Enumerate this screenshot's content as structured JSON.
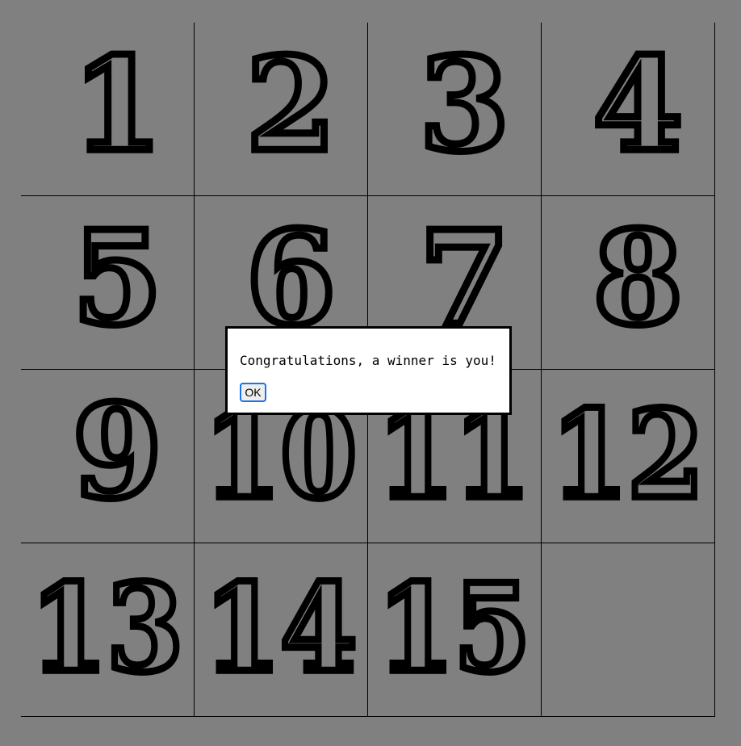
{
  "game": {
    "tiles": [
      "1",
      "2",
      "3",
      "4",
      "5",
      "6",
      "7",
      "8",
      "9",
      "10",
      "11",
      "12",
      "13",
      "14",
      "15",
      ""
    ],
    "colors": {
      "background": "#808080",
      "tile_fill": "#808080",
      "digit_outline": "#000000",
      "grid_line": "#000000"
    }
  },
  "dialog": {
    "message": "Congratulations, a winner is you!",
    "ok_label": "OK"
  }
}
